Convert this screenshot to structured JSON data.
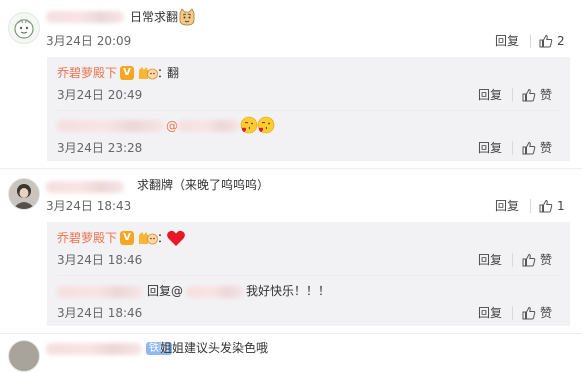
{
  "comments": [
    {
      "text": "日常求翻",
      "date": "3月24日 20:09",
      "reply_label": "回复",
      "like_count": "2",
      "replies": [
        {
          "author": "乔碧萝殿下",
          "separator": "：",
          "text": "翻",
          "date": "3月24日 20:49",
          "reply_label": "回复",
          "like_label": "赞"
        },
        {
          "mention": "@",
          "date": "3月24日 23:28",
          "reply_label": "回复",
          "like_label": "赞"
        }
      ]
    },
    {
      "text": "求翻牌（来晚了呜呜呜）",
      "date": "3月24日 18:43",
      "reply_label": "回复",
      "like_count": "1",
      "replies": [
        {
          "author": "乔碧萝殿下",
          "separator": "：",
          "date": "3月24日 18:46",
          "reply_label": "回复",
          "like_label": "赞"
        },
        {
          "text_prefix": "回复@",
          "text_suffix": "我好快乐！！！",
          "date": "3月24日 18:46",
          "reply_label": "回复",
          "like_label": "赞"
        }
      ]
    },
    {
      "badge": "铁粉",
      "text": "姐姐建议头发染色哦"
    }
  ],
  "badges": {
    "verified": "V"
  },
  "icons": {
    "like": "thumbs-up-icon",
    "verified": "verified-v-badge",
    "crown_fan": "fan-crown-icon",
    "heart": "red-heart-icon",
    "kiss": "blowing-kiss-emoji",
    "cat": "cat-emoji"
  },
  "colors": {
    "username": "#eb7350",
    "panel_bg": "#f2f2f5",
    "heart": "#e5192a",
    "verified": "#f6a623"
  }
}
